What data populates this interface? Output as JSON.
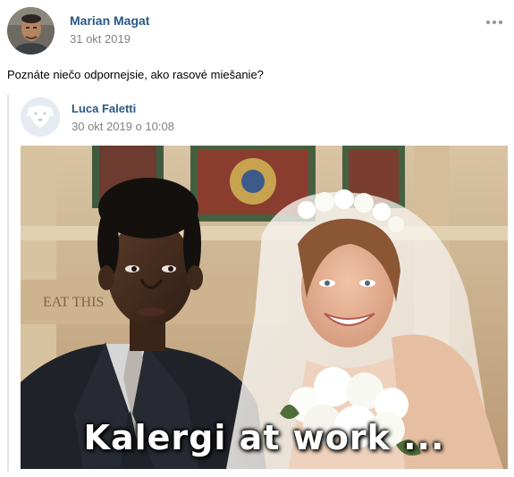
{
  "post": {
    "author": "Marian Magat",
    "date": "31 okt 2019",
    "text": "Poznáte niečo odpornejsie, ako rasové miešanie?",
    "more_icon": "more-horizontal-icon"
  },
  "repost": {
    "author": "Luca Faletti",
    "date": "30 okt 2019 o 10:08",
    "avatar_icon": "deactivated-dog-icon",
    "photo": {
      "caption": "Kalergi at work ...",
      "background_sign": "EAT THIS"
    }
  }
}
